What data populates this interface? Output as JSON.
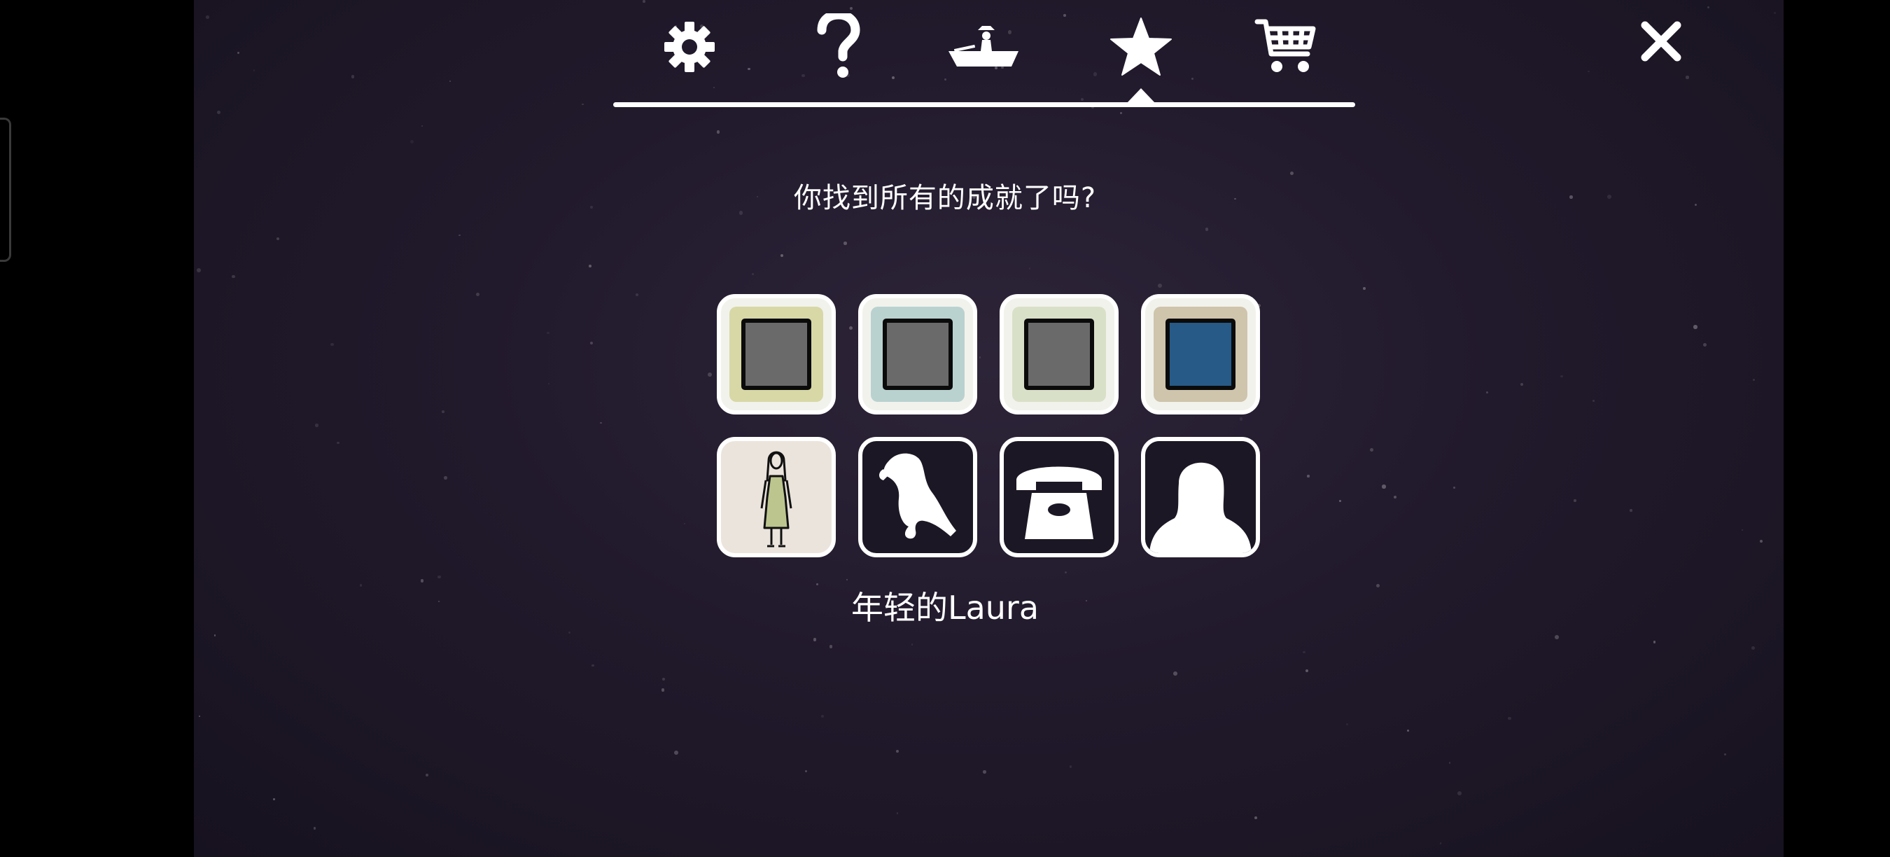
{
  "tabs": [
    {
      "name": "settings",
      "icon": "gear-icon"
    },
    {
      "name": "help",
      "icon": "question-mark-icon"
    },
    {
      "name": "boat",
      "icon": "fisherman-boat-icon"
    },
    {
      "name": "achievements",
      "icon": "star-icon",
      "active": true
    },
    {
      "name": "shop",
      "icon": "shopping-cart-icon"
    }
  ],
  "close_icon": "close-icon",
  "question": "你找到所有的成就了吗?",
  "achievements": {
    "row1": [
      {
        "frame_color": "#d7d8a6",
        "square_color": "#6a6a6a",
        "state": "unlocked"
      },
      {
        "frame_color": "#b9d2d0",
        "square_color": "#6a6a6a",
        "state": "unlocked"
      },
      {
        "frame_color": "#d9e0c8",
        "square_color": "#6a6a6a",
        "state": "unlocked"
      },
      {
        "frame_color": "#cfc4ac",
        "square_color": "#275a86",
        "state": "unlocked"
      }
    ],
    "row2": [
      {
        "icon": "young-woman-figure-icon",
        "state": "unlocked",
        "selected": true
      },
      {
        "icon": "parrot-silhouette-icon",
        "state": "locked"
      },
      {
        "icon": "telephone-silhouette-icon",
        "state": "locked"
      },
      {
        "icon": "person-silhouette-icon",
        "state": "locked"
      }
    ]
  },
  "selected_label": "年轻的Laura",
  "colors": {
    "background": "#211a2c",
    "accent": "#ffffff",
    "figure_dress": "#bcc58e",
    "figure_tile_bg": "#ebe4dc"
  }
}
